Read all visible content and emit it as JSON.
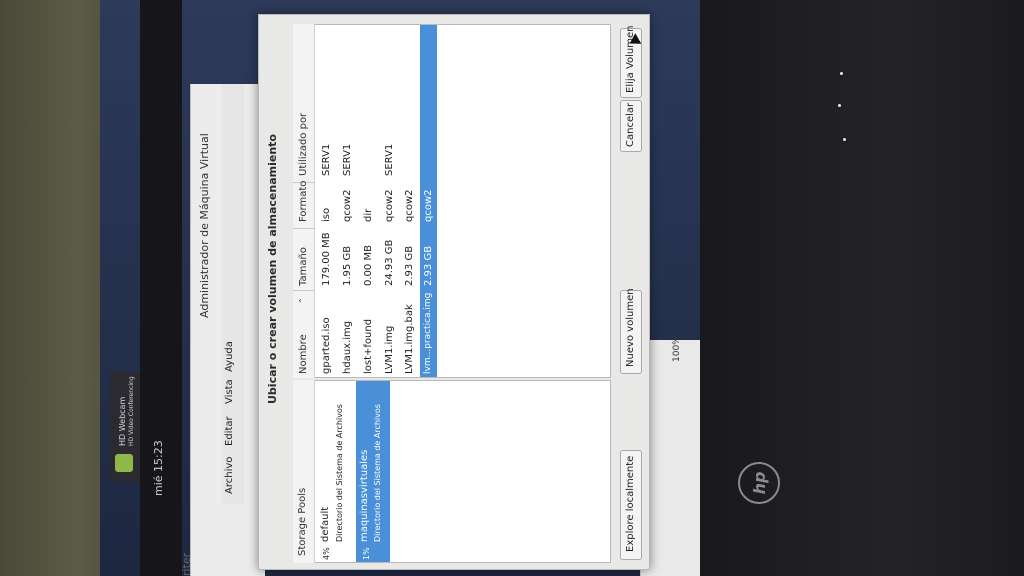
{
  "desktop": {
    "clock": "mié 15:23",
    "notification": {
      "title": "HD Webcam",
      "subtitle": "HD Video Conferencing"
    },
    "brand_logo": "hp"
  },
  "background_window": {
    "title": "Administrador de Máquina Virtual",
    "menu": [
      "Archivo",
      "Editar",
      "Vista",
      "Ayuda"
    ],
    "left_fragment": "riter",
    "zoom": "100%"
  },
  "dialog": {
    "title": "Ubicar o crear volumen de almacenamiento",
    "pools_header": "Storage Pools",
    "pools": [
      {
        "usage": "4%",
        "name": "default",
        "type": "Directorio del Sistema de Archivos",
        "selected": false
      },
      {
        "usage": "1%",
        "name": "maquinasvirtuales",
        "type": "Directorio del Sistema de Archivos",
        "selected": true
      }
    ],
    "volumes_columns": [
      "Nombre",
      "Tamaño",
      "Formato",
      "Utilizado por"
    ],
    "volumes": [
      {
        "name": "gparted.iso",
        "size": "179.00 MB",
        "format": "iso",
        "used_by": "SERV1",
        "selected": false
      },
      {
        "name": "hdaux.img",
        "size": "1.95 GB",
        "format": "qcow2",
        "used_by": "SERV1",
        "selected": false
      },
      {
        "name": "lost+found",
        "size": "0.00 MB",
        "format": "dir",
        "used_by": "",
        "selected": false
      },
      {
        "name": "LVM1.img",
        "size": "24.93 GB",
        "format": "qcow2",
        "used_by": "SERV1",
        "selected": false
      },
      {
        "name": "LVM1.img.bak",
        "size": "2.93 GB",
        "format": "qcow2",
        "used_by": "",
        "selected": false
      },
      {
        "name": "lvm...practica.img",
        "size": "2.93 GB",
        "format": "qcow2",
        "used_by": "",
        "selected": true
      }
    ],
    "buttons": {
      "browse_local": "Explore localmente",
      "new_volume": "Nuevo volumen",
      "cancel": "Cancelar",
      "choose_volume": "Elija Volumen"
    },
    "colors": {
      "selection": "#4a90d9"
    }
  }
}
